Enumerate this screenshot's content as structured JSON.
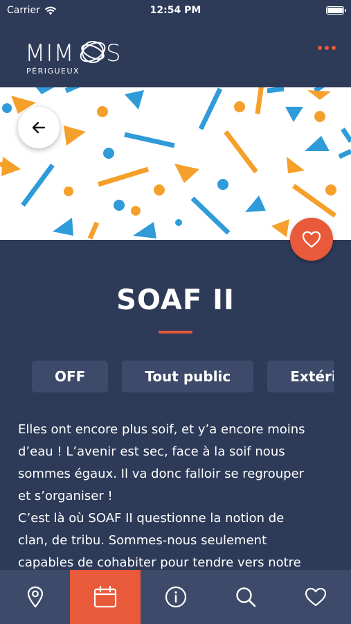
{
  "status_bar": {
    "carrier": "Carrier",
    "time": "12:54 PM"
  },
  "header": {
    "logo_text": "MIMOS",
    "logo_subtitle": "PÉRIGUEUX"
  },
  "event": {
    "title": "SOAF II",
    "tags": [
      "OFF",
      "Tout public",
      "Extérieur"
    ],
    "description_lines": [
      "Elles ont encore plus soif, et y’a encore moins",
      "d’eau ! L’avenir est sec, face à la soif nous",
      "sommes égaux. Il va donc falloir se regrouper",
      "et s’organiser !",
      "C’est là où SOAF II questionne la notion de",
      "clan, de tribu. Sommes-nous seulement",
      "capables de cohabiter pour tendre vers notre"
    ]
  },
  "colors": {
    "accent": "#e85a3a",
    "background": "#2d3a58",
    "tab_bar": "#3e4a69",
    "orange": "#f5a02a",
    "blue": "#2f9bd9"
  },
  "tab_bar": {
    "items": [
      {
        "icon": "map-pin-icon",
        "active": false
      },
      {
        "icon": "calendar-icon",
        "active": true
      },
      {
        "icon": "info-icon",
        "active": false
      },
      {
        "icon": "search-icon",
        "active": false
      },
      {
        "icon": "heart-icon",
        "active": false
      }
    ]
  }
}
